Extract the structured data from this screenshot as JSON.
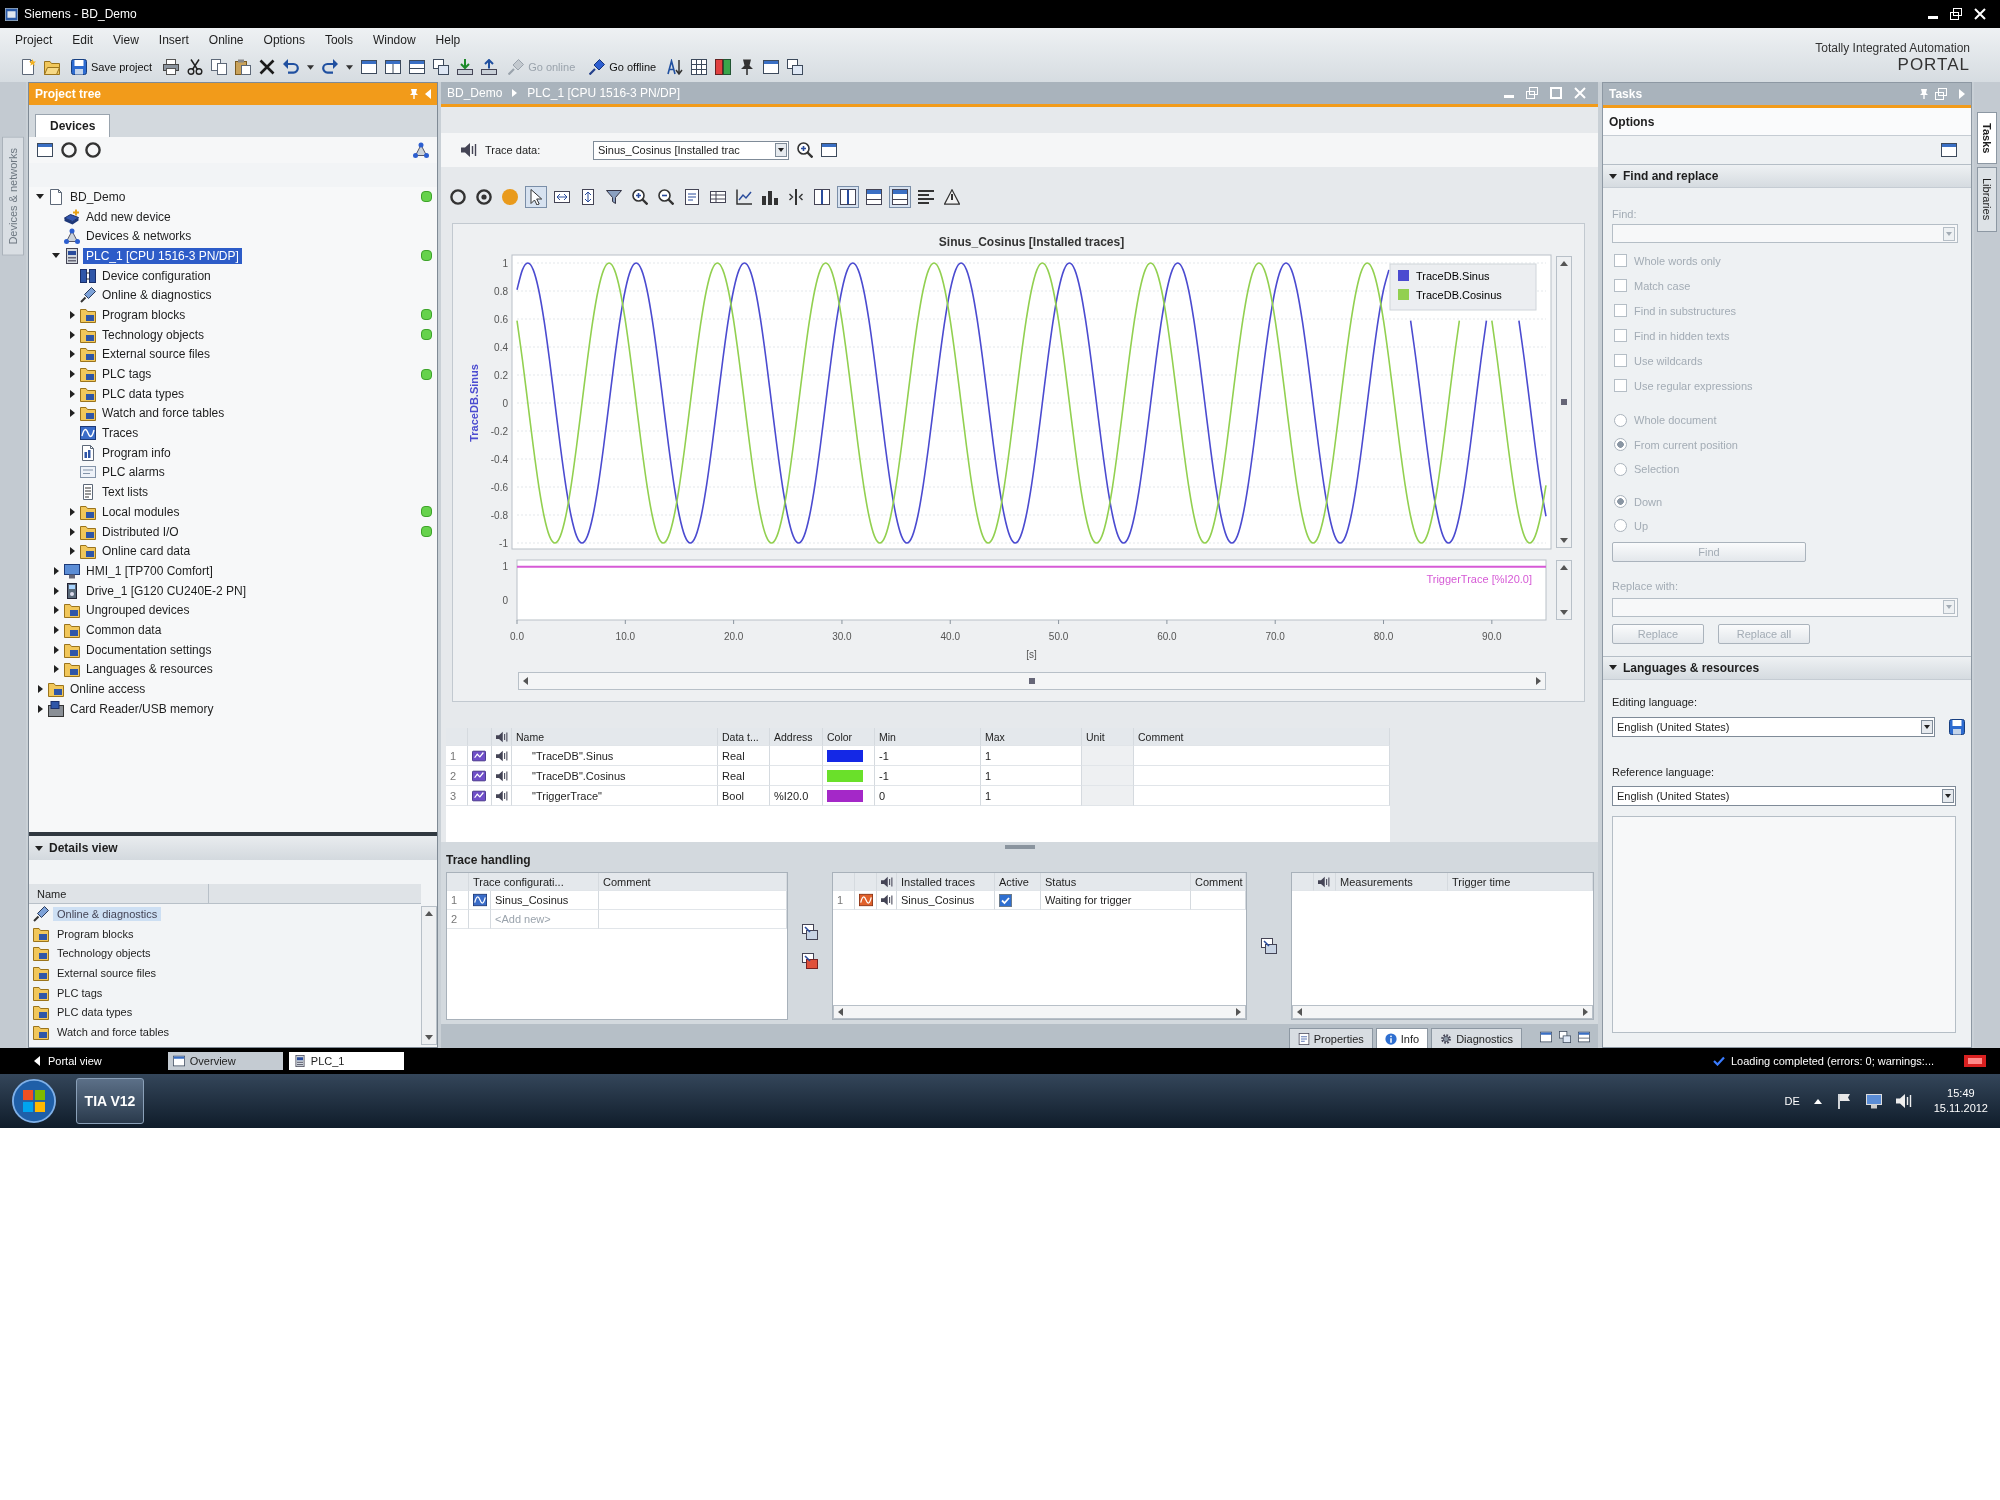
{
  "window": {
    "title": "Siemens - BD_Demo"
  },
  "menu": [
    "Project",
    "Edit",
    "View",
    "Insert",
    "Online",
    "Options",
    "Tools",
    "Window",
    "Help"
  ],
  "toolbar": {
    "save_label": "Save project",
    "go_online": {
      "label": "Go online",
      "disabled": true
    },
    "go_offline": {
      "label": "Go offline",
      "disabled": false
    }
  },
  "brand": {
    "line_1": "Totally Integrated Automation",
    "line_2": "PORTAL"
  },
  "left_strip": {
    "label": "Devices & networks"
  },
  "project_tree": {
    "title": "Project tree",
    "active": true,
    "tabs": [
      {
        "label": "Devices",
        "selected": true
      }
    ],
    "items": [
      {
        "label": "BD_Demo",
        "kind": "project",
        "expanded": true,
        "selected": false,
        "online_ok": true,
        "children": [
          {
            "label": "Add new device",
            "kind": "add",
            "selected": false,
            "online_ok": false
          },
          {
            "label": "Devices & networks",
            "kind": "network",
            "selected": false,
            "online_ok": false
          },
          {
            "label": "PLC_1 [CPU 1516-3 PN/DP]",
            "kind": "plc",
            "expanded": true,
            "selected": true,
            "online_ok": true,
            "children": [
              {
                "label": "Device configuration",
                "kind": "config",
                "selected": false,
                "online_ok": false
              },
              {
                "label": "Online & diagnostics",
                "kind": "diag",
                "selected": false,
                "online_ok": false
              },
              {
                "label": "Program blocks",
                "kind": "folder",
                "expanded": false,
                "selected": false,
                "online_ok": true
              },
              {
                "label": "Technology objects",
                "kind": "folder",
                "expanded": false,
                "selected": false,
                "online_ok": true
              },
              {
                "label": "External source files",
                "kind": "folder",
                "expanded": false,
                "selected": false,
                "online_ok": false
              },
              {
                "label": "PLC tags",
                "kind": "folder",
                "expanded": false,
                "selected": false,
                "online_ok": true
              },
              {
                "label": "PLC data types",
                "kind": "folder",
                "expanded": false,
                "selected": false,
                "online_ok": false
              },
              {
                "label": "Watch and force tables",
                "kind": "folder",
                "expanded": false,
                "selected": false,
                "online_ok": false
              },
              {
                "label": "Traces",
                "kind": "trace",
                "selected": false,
                "online_ok": false
              },
              {
                "label": "Program info",
                "kind": "info",
                "selected": false,
                "online_ok": false
              },
              {
                "label": "PLC alarms",
                "kind": "alarms",
                "selected": false,
                "online_ok": false
              },
              {
                "label": "Text lists",
                "kind": "textlist",
                "selected": false,
                "online_ok": false
              },
              {
                "label": "Local modules",
                "kind": "folder",
                "expanded": false,
                "selected": false,
                "online_ok": true
              },
              {
                "label": "Distributed I/O",
                "kind": "folder",
                "expanded": false,
                "selected": false,
                "online_ok": true
              },
              {
                "label": "Online card data",
                "kind": "folder",
                "expanded": false,
                "selected": false,
                "online_ok": false
              }
            ]
          },
          {
            "label": "HMI_1 [TP700 Comfort]",
            "kind": "hmi",
            "expanded": false,
            "selected": false,
            "online_ok": false
          },
          {
            "label": "Drive_1 [G120 CU240E-2 PN]",
            "kind": "drive",
            "expanded": false,
            "selected": false,
            "online_ok": false
          },
          {
            "label": "Ungrouped devices",
            "kind": "folder",
            "expanded": false,
            "selected": false,
            "online_ok": false
          },
          {
            "label": "Common data",
            "kind": "folder",
            "expanded": false,
            "selected": false,
            "online_ok": false
          },
          {
            "label": "Documentation settings",
            "kind": "folder",
            "expanded": false,
            "selected": false,
            "online_ok": false
          },
          {
            "label": "Languages & resources",
            "kind": "folder",
            "expanded": false,
            "selected": false,
            "online_ok": false
          }
        ]
      },
      {
        "label": "Online access",
        "kind": "folder",
        "expanded": false,
        "selected": false,
        "online_ok": false
      },
      {
        "label": "Card Reader/USB memory",
        "kind": "card",
        "expanded": false,
        "selected": false,
        "online_ok": false
      }
    ]
  },
  "details_view": {
    "title": "Details view",
    "expanded": true,
    "columns": [
      "Name"
    ],
    "rows": [
      {
        "label": "Online & diagnostics",
        "kind": "diag",
        "selected": true
      },
      {
        "label": "Program blocks",
        "kind": "folder",
        "selected": false
      },
      {
        "label": "Technology objects",
        "kind": "folder",
        "selected": false
      },
      {
        "label": "External source files",
        "kind": "folder",
        "selected": false
      },
      {
        "label": "PLC tags",
        "kind": "folder",
        "selected": false
      },
      {
        "label": "PLC data types",
        "kind": "folder",
        "selected": false
      },
      {
        "label": "Watch and force tables",
        "kind": "folder",
        "selected": false
      }
    ]
  },
  "editor": {
    "active": false,
    "breadcrumb": [
      "BD_Demo",
      "PLC_1 [CPU 1516-3 PN/DP]"
    ],
    "trace_data": {
      "label": "Trace data:",
      "value": "Sinus_Cosinus [Installed trac"
    },
    "chart_toolbar": [
      {
        "kind": "ring",
        "pressed": false
      },
      {
        "kind": "target",
        "pressed": false
      },
      {
        "kind": "dot",
        "pressed": false
      },
      {
        "kind": "cursor",
        "pressed": true
      },
      {
        "kind": "hzoom",
        "pressed": false
      },
      {
        "kind": "vzoom",
        "pressed": false
      },
      {
        "kind": "funnel",
        "pressed": false
      },
      {
        "kind": "zoomin",
        "pressed": false
      },
      {
        "kind": "zoomout",
        "pressed": false
      },
      {
        "kind": "doc",
        "pressed": false
      },
      {
        "kind": "table",
        "pressed": false
      },
      {
        "kind": "linechart",
        "pressed": false
      },
      {
        "kind": "bars",
        "pressed": false
      },
      {
        "kind": "vline",
        "pressed": false
      },
      {
        "kind": "split",
        "pressed": false
      },
      {
        "kind": "split",
        "pressed": true
      },
      {
        "kind": "rows",
        "pressed": false
      },
      {
        "kind": "rows",
        "pressed": true
      },
      {
        "kind": "align",
        "pressed": false
      },
      {
        "kind": "triangle",
        "pressed": false
      }
    ],
    "trace_chart": {
      "chart_data": {
        "type": "line",
        "title": "Sinus_Cosinus [Installed traces]",
        "ylabel": "TraceDB.Sinus",
        "grid": true,
        "legend": "upper right",
        "xlim": [
          0,
          95
        ],
        "ylim": [
          -1,
          1
        ],
        "yticks": [
          -1,
          -0.8,
          -0.6,
          -0.4,
          -0.2,
          0,
          0.2,
          0.4,
          0.6,
          0.8,
          1
        ],
        "x": [
          0,
          0.5,
          1,
          1.5,
          2,
          2.5,
          3,
          3.5,
          4,
          4.5,
          5,
          5.5,
          6,
          6.5,
          7,
          7.5,
          8,
          8.5,
          9,
          9.5,
          10,
          10.5,
          11,
          11.5,
          12,
          12.5,
          13,
          13.5,
          14,
          14.5,
          15,
          15.5,
          16,
          16.5,
          17,
          17.5,
          18,
          18.5,
          19,
          19.5,
          20,
          20.5,
          21,
          21.5,
          22,
          22.5,
          23,
          23.5,
          24,
          24.5,
          25,
          25.5,
          26,
          26.5,
          27,
          27.5,
          28,
          28.5,
          29,
          29.5,
          30,
          30.5,
          31,
          31.5,
          32,
          32.5,
          33,
          33.5,
          34,
          34.5,
          35,
          35.5,
          36,
          36.5,
          37,
          37.5,
          38,
          38.5,
          39,
          39.5,
          40,
          40.5,
          41,
          41.5,
          42,
          42.5,
          43,
          43.5,
          44,
          44.5,
          45,
          45.5,
          46,
          46.5,
          47,
          47.5,
          48,
          48.5,
          49,
          49.5,
          50,
          50.5,
          51,
          51.5,
          52,
          52.5,
          53,
          53.5,
          54,
          54.5,
          55,
          55.5,
          56,
          56.5,
          57,
          57.5,
          58,
          58.5,
          59,
          59.5,
          60,
          60.5,
          61,
          61.5,
          62,
          62.5,
          63,
          63.5,
          64,
          64.5,
          65,
          65.5,
          66,
          66.5,
          67,
          67.5,
          68,
          68.5,
          69,
          69.5,
          70,
          70.5,
          71,
          71.5,
          72,
          72.5,
          73,
          73.5,
          74,
          74.5,
          75,
          75.5,
          76,
          76.5,
          77,
          77.5,
          78,
          78.5,
          79,
          79.5,
          80,
          80.5,
          81,
          81.5,
          82,
          82.5,
          83,
          83.5,
          84,
          84.5,
          85,
          85.5,
          86,
          86.5,
          87,
          87.5,
          88,
          88.5,
          89,
          89.5,
          90,
          90.5,
          91,
          91.5,
          92,
          92.5,
          93,
          93.5,
          94,
          94.5,
          95
        ],
        "series": [
          {
            "name": "TraceDB.Sinus",
            "color": "#4b4bd0",
            "values": [
              0.809,
              0.951,
              1,
              0.951,
              0.809,
              0.588,
              0.309,
              0,
              -0.309,
              -0.588,
              -0.809,
              -0.951,
              -1,
              -0.951,
              -0.809,
              -0.588,
              -0.309,
              0,
              0.309,
              0.588,
              0.809,
              0.951,
              1,
              0.951,
              0.809,
              0.588,
              0.309,
              0,
              -0.309,
              -0.588,
              -0.809,
              -0.951,
              -1,
              -0.951,
              -0.809,
              -0.588,
              -0.309,
              0,
              0.309,
              0.588,
              0.809,
              0.951,
              1,
              0.951,
              0.809,
              0.588,
              0.309,
              0,
              -0.309,
              -0.588,
              -0.809,
              -0.951,
              -1,
              -0.951,
              -0.809,
              -0.588,
              -0.309,
              0,
              0.309,
              0.588,
              0.809,
              0.951,
              1,
              0.951,
              0.809,
              0.588,
              0.309,
              0,
              -0.309,
              -0.588,
              -0.809,
              -0.951,
              -1,
              -0.951,
              -0.809,
              -0.588,
              -0.309,
              0,
              0.309,
              0.588,
              0.809,
              0.951,
              1,
              0.951,
              0.809,
              0.588,
              0.309,
              0,
              -0.309,
              -0.588,
              -0.809,
              -0.951,
              -1,
              -0.951,
              -0.809,
              -0.588,
              -0.309,
              0,
              0.309,
              0.588,
              0.809,
              0.951,
              1,
              0.951,
              0.809,
              0.588,
              0.309,
              0,
              -0.309,
              -0.588,
              -0.809,
              -0.951,
              -1,
              -0.951,
              -0.809,
              -0.588,
              -0.309,
              0,
              0.309,
              0.588,
              0.809,
              0.951,
              1,
              0.951,
              0.809,
              0.588,
              0.309,
              0,
              -0.309,
              -0.588,
              -0.809,
              -0.951,
              -1,
              -0.951,
              -0.809,
              -0.588,
              -0.309,
              0,
              0.309,
              0.588,
              0.809,
              0.951,
              1,
              0.951,
              0.809,
              0.588,
              0.309,
              0,
              -0.309,
              -0.588,
              -0.809,
              -0.951,
              -1,
              -0.951,
              -0.809,
              -0.588,
              -0.309,
              0,
              0.309,
              0.588,
              0.809,
              0.951,
              null,
              null,
              null,
              0.588,
              0.309,
              0,
              -0.309,
              -0.588,
              -0.809,
              -0.951,
              -1,
              -0.951,
              -0.809,
              -0.588,
              -0.309,
              0,
              0.309,
              0.588,
              null,
              null,
              null,
              null,
              null,
              0.588,
              0.309,
              0,
              -0.309,
              -0.588,
              -0.809
            ]
          },
          {
            "name": "TraceDB.Cosinus",
            "color": "#92d050",
            "values": [
              0.588,
              0.309,
              0,
              -0.309,
              -0.588,
              -0.809,
              -0.951,
              -1,
              -0.951,
              -0.809,
              -0.588,
              -0.309,
              0,
              0.309,
              0.588,
              0.809,
              0.951,
              1,
              0.951,
              0.809,
              0.588,
              0.309,
              0,
              -0.309,
              -0.588,
              -0.809,
              -0.951,
              -1,
              -0.951,
              -0.809,
              -0.588,
              -0.309,
              0,
              0.309,
              0.588,
              0.809,
              0.951,
              1,
              0.951,
              0.809,
              0.588,
              0.309,
              0,
              -0.309,
              -0.588,
              -0.809,
              -0.951,
              -1,
              -0.951,
              -0.809,
              -0.588,
              -0.309,
              0,
              0.309,
              0.588,
              0.809,
              0.951,
              1,
              0.951,
              0.809,
              0.588,
              0.309,
              0,
              -0.309,
              -0.588,
              -0.809,
              -0.951,
              -1,
              -0.951,
              -0.809,
              -0.588,
              -0.309,
              0,
              0.309,
              0.588,
              0.809,
              0.951,
              1,
              0.951,
              0.809,
              0.588,
              0.309,
              0,
              -0.309,
              -0.588,
              -0.809,
              -0.951,
              -1,
              -0.951,
              -0.809,
              -0.588,
              -0.309,
              0,
              0.309,
              0.588,
              0.809,
              0.951,
              1,
              0.951,
              0.809,
              0.588,
              0.309,
              0,
              -0.309,
              -0.588,
              -0.809,
              -0.951,
              -1,
              -0.951,
              -0.809,
              -0.588,
              -0.309,
              0,
              0.309,
              0.588,
              0.809,
              0.951,
              1,
              0.951,
              0.809,
              0.588,
              0.309,
              0,
              -0.309,
              -0.588,
              -0.809,
              -0.951,
              -1,
              -0.951,
              -0.809,
              -0.588,
              -0.309,
              0,
              0.309,
              0.588,
              0.809,
              0.951,
              1,
              0.951,
              0.809,
              0.588,
              0.309,
              0,
              -0.309,
              -0.588,
              -0.809,
              -0.951,
              -1,
              -0.951,
              -0.809,
              -0.588,
              -0.309,
              0,
              0.309,
              0.588,
              0.809,
              0.951,
              1,
              0.951,
              0.809,
              0.588,
              0.309,
              0,
              -0.309,
              -0.588,
              -0.809,
              -0.951,
              -1,
              -0.951,
              -0.809,
              -0.588,
              -0.309,
              0,
              0.309,
              0.588,
              null,
              null,
              null,
              null,
              null,
              0.588,
              0.309,
              0,
              -0.309,
              -0.588,
              -0.809,
              -0.951,
              -1,
              -0.951,
              -0.809,
              -0.588
            ]
          }
        ]
      }
    },
    "bit_chart": {
      "chart_data": {
        "type": "line",
        "xlabel": "[s]",
        "x": [
          0,
          95
        ],
        "xlim": [
          0,
          95
        ],
        "ylim": [
          -0.6,
          1.2
        ],
        "yticks": [
          0,
          1
        ],
        "xticks": [
          {
            "value": 0,
            "label": "0.0"
          },
          {
            "value": 10,
            "label": "10.0"
          },
          {
            "value": 20,
            "label": "20.0"
          },
          {
            "value": 30,
            "label": "30.0"
          },
          {
            "value": 40,
            "label": "40.0"
          },
          {
            "value": 50,
            "label": "50.0"
          },
          {
            "value": 60,
            "label": "60.0"
          },
          {
            "value": 70,
            "label": "70.0"
          },
          {
            "value": 80,
            "label": "80.0"
          },
          {
            "value": 90,
            "label": "90.0"
          }
        ],
        "series": [
          {
            "name": "TriggerTrace [%I20.0]",
            "color": "#d65ad6",
            "values": [
              1,
              1
            ]
          }
        ]
      }
    },
    "signal_table": {
      "columns": [
        "Name",
        "Data t...",
        "Address",
        "Color",
        "Min",
        "Max",
        "Unit",
        "Comment"
      ],
      "rows": [
        {
          "number": "1",
          "name": "\"TraceDB\".Sinus",
          "data_type": "Real",
          "color": "#1428e6",
          "min": "-1",
          "max": "1"
        },
        {
          "number": "2",
          "name": "\"TraceDB\".Cosinus",
          "data_type": "Real",
          "color": "#6ae02a",
          "min": "-1",
          "max": "1"
        },
        {
          "number": "3",
          "name": "\"TriggerTrace\"",
          "data_type": "Bool",
          "address": "%I20.0",
          "color": "#a428c8",
          "min": "0",
          "max": "1"
        }
      ]
    },
    "trace_handling": {
      "title": "Trace handling",
      "configurations": {
        "columns": [
          "Trace configurati...",
          "Comment"
        ],
        "rows": [
          {
            "number": "1",
            "name": "Sinus_Cosinus",
            "kind": "trace"
          },
          {
            "number": "2",
            "name": "<Add new>",
            "kind": "add_new"
          }
        ]
      },
      "installed": {
        "columns": [
          "Installed traces",
          "Active",
          "Status",
          "Comment"
        ],
        "rows": [
          {
            "number": "1",
            "name": "Sinus_Cosinus",
            "active": true,
            "status": "Waiting for trigger"
          }
        ]
      },
      "measurements": {
        "columns": [
          "Measurements",
          "Trigger time"
        ]
      }
    },
    "inspector_tabs": [
      {
        "label": "Properties",
        "selected": false
      },
      {
        "label": "Info",
        "selected": true
      },
      {
        "label": "Diagnostics",
        "selected": false
      }
    ]
  },
  "task_card": {
    "title": "Tasks",
    "active": false,
    "pane": "Options",
    "find_replace": {
      "title": "Find and replace",
      "expanded": true,
      "disabled": true,
      "find_label": "Find:",
      "options": [
        {
          "label": "Whole words only",
          "checked": false
        },
        {
          "label": "Match case",
          "checked": false
        },
        {
          "label": "Find in substructures",
          "checked": false
        },
        {
          "label": "Find in hidden texts",
          "checked": false
        },
        {
          "label": "Use wildcards",
          "checked": false
        },
        {
          "label": "Use regular expressions",
          "checked": false
        }
      ],
      "scope": [
        {
          "label": "Whole document",
          "selected": false
        },
        {
          "label": "From current position",
          "selected": true
        },
        {
          "label": "Selection",
          "selected": false
        }
      ],
      "direction": [
        {
          "label": "Down",
          "selected": true
        },
        {
          "label": "Up",
          "selected": false
        }
      ],
      "find_button": "Find",
      "replace_label": "Replace with:",
      "replace_button": "Replace",
      "replace_all_button": "Replace all"
    },
    "languages": {
      "title": "Languages & resources",
      "expanded": true,
      "editing_label": "Editing language:",
      "editing_value": "English (United States)",
      "reference_label": "Reference language:",
      "reference_value": "English (United States)"
    }
  },
  "side_tabs": [
    {
      "label": "Tasks",
      "selected": true
    },
    {
      "label": "Libraries",
      "selected": false
    }
  ],
  "status_bar": {
    "portal_view": "Portal view",
    "editors": [
      {
        "label": "Overview",
        "selected": false
      },
      {
        "label": "PLC_1",
        "selected": true
      }
    ],
    "message": "Loading completed (errors: 0; warnings:..."
  },
  "taskbar": {
    "app_label": "TIA V12",
    "language": "DE",
    "time": "15:49",
    "date": "15.11.2012"
  }
}
